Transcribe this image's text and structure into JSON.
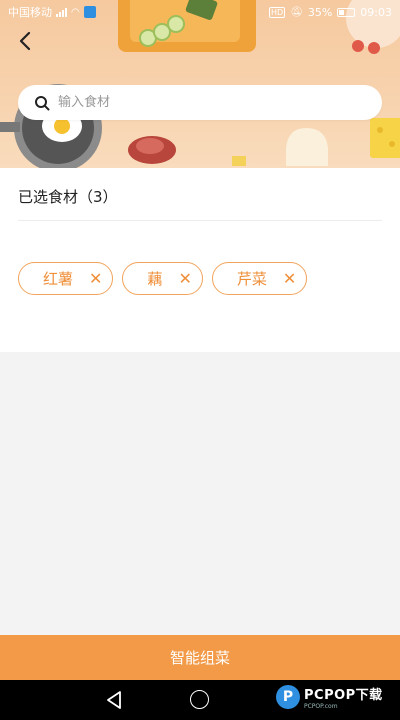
{
  "status_bar": {
    "carrier": "中国移动",
    "battery": "35%",
    "time": "09:03"
  },
  "header": {
    "back_icon": "back-arrow-icon"
  },
  "search": {
    "placeholder": "输入食材",
    "value": ""
  },
  "selected": {
    "title": "已选食材（3）",
    "items": [
      {
        "label": "红薯",
        "remove_icon": "close-icon"
      },
      {
        "label": "藕",
        "remove_icon": "close-icon"
      },
      {
        "label": "芹菜",
        "remove_icon": "close-icon"
      }
    ]
  },
  "action": {
    "label": "智能组菜"
  },
  "colors": {
    "accent": "#f29a47",
    "chip_border": "#f2a45d",
    "chip_text": "#ef8f3a",
    "header_bg": "#f7d2ad"
  },
  "watermark": {
    "logo_letter": "P",
    "text": "PCPOP下载",
    "sub": "PCPOP.com"
  }
}
